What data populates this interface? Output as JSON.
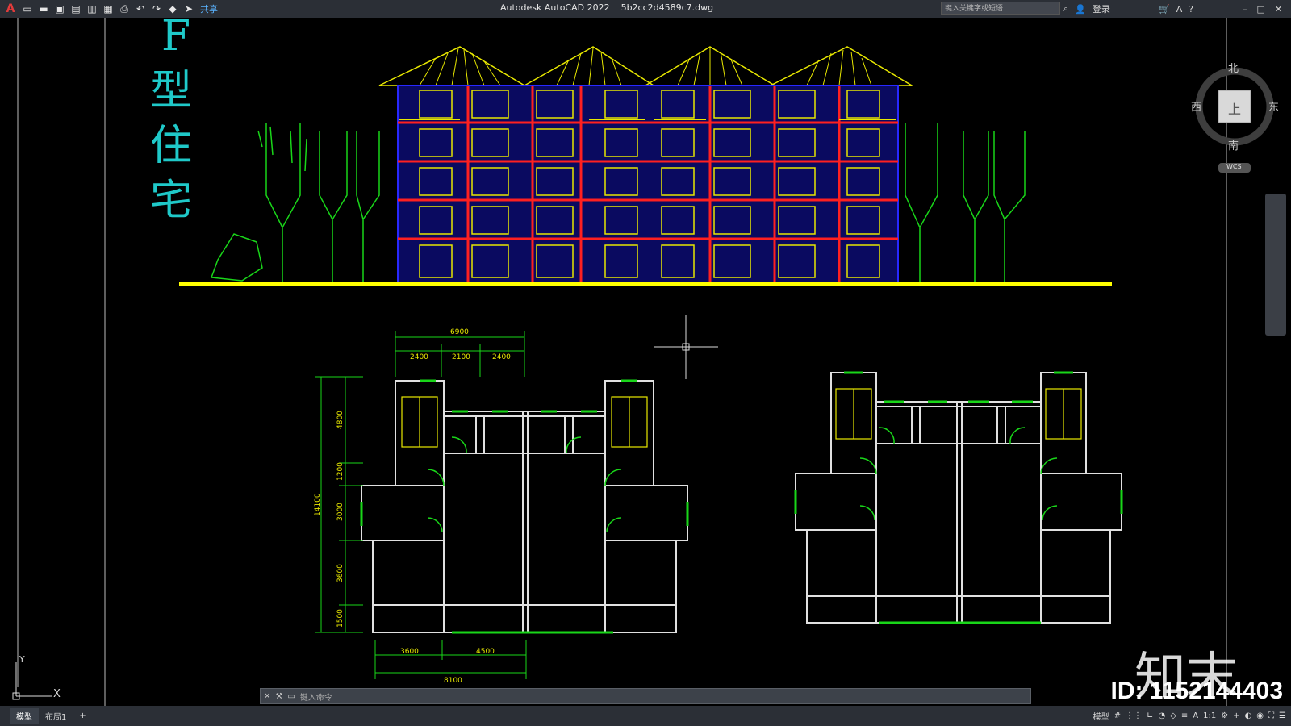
{
  "titlebar": {
    "app_title": "Autodesk AutoCAD 2022    5b2cc2d4589c7.dwg",
    "share_label": "共享",
    "search_placeholder": "键入关键字或短语",
    "login_label": "登录"
  },
  "viewcube": {
    "north": "北",
    "south": "南",
    "east": "东",
    "west": "西",
    "top": "上",
    "wcs": "WCS"
  },
  "drawing": {
    "title_chars": [
      "F",
      "型",
      "住",
      "宅"
    ],
    "dims_top": {
      "total": "6900",
      "a": "2400",
      "b": "2100",
      "c": "2400"
    },
    "dims_left": {
      "total": "14100",
      "a": "4800",
      "b": "1200",
      "c": "3000",
      "d": "3600",
      "e": "1500"
    },
    "dims_bottom": {
      "a": "3600",
      "b": "4500",
      "total": "8100"
    }
  },
  "ucs": {
    "x": "X",
    "y": "Y"
  },
  "command": {
    "placeholder": "键入命令"
  },
  "layout_tabs": [
    "模型",
    "布局1"
  ],
  "add_tab": "+",
  "status": {
    "model_label": "模型",
    "scale": "1:1"
  },
  "watermark": {
    "brand": "知末",
    "id": "ID: 1152144403"
  },
  "colors": {
    "wall": "#e0e0e0",
    "green": "#19d619",
    "yellow": "#e8e800",
    "red": "#ff2020",
    "blue": "#2828ff",
    "cyan": "#1fc9c9"
  }
}
